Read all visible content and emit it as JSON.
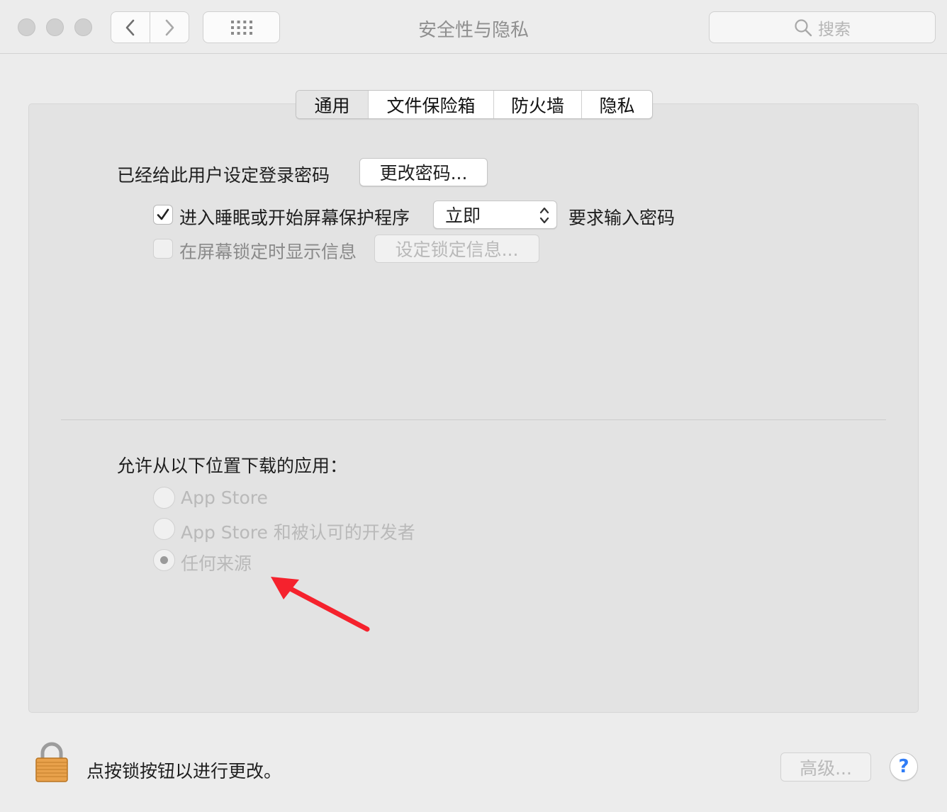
{
  "window": {
    "title": "安全性与隐私",
    "search_placeholder": "搜索"
  },
  "tabs": [
    {
      "label": "通用",
      "active": true
    },
    {
      "label": "文件保险箱",
      "active": false
    },
    {
      "label": "防火墙",
      "active": false
    },
    {
      "label": "隐私",
      "active": false
    }
  ],
  "general": {
    "password_label": "已经给此用户设定登录密码",
    "change_password_button": "更改密码...",
    "require_password": {
      "checked": true,
      "label": "进入睡眠或开始屏幕保护程序",
      "select_value": "立即",
      "suffix": "要求输入密码"
    },
    "lock_message": {
      "checked": false,
      "label": "在屏幕锁定时显示信息",
      "button": "设定锁定信息..."
    }
  },
  "downloads": {
    "heading": "允许从以下位置下载的应用：",
    "options": [
      {
        "label": "App Store",
        "selected": false
      },
      {
        "label": "App Store 和被认可的开发者",
        "selected": false
      },
      {
        "label": "任何来源",
        "selected": true
      }
    ]
  },
  "footer": {
    "lock_text": "点按锁按钮以进行更改。",
    "advanced_button": "高级...",
    "help_button": "?"
  },
  "colors": {
    "annotation_arrow": "#f5222d",
    "help_accent": "#2f7cf6",
    "lock_body": "#e8a14b"
  }
}
